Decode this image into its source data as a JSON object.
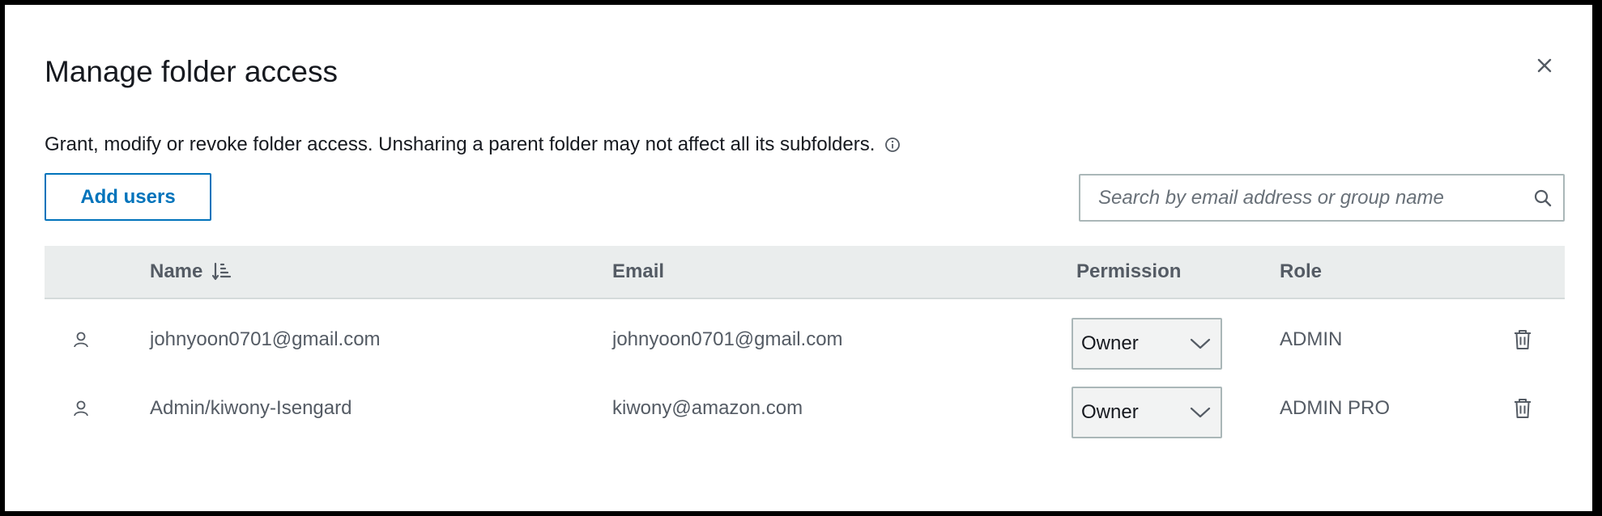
{
  "dialog": {
    "title": "Manage folder access",
    "close_icon": "close-icon",
    "description": "Grant, modify or revoke folder access. Unsharing a parent folder may not affect all its subfolders.",
    "info_icon": "info-icon"
  },
  "toolbar": {
    "add_users_label": "Add users",
    "search_placeholder": "Search by email address or group name",
    "search_value": "",
    "search_icon": "search-icon"
  },
  "table": {
    "columns": {
      "name": "Name",
      "email": "Email",
      "permission": "Permission",
      "role": "Role"
    },
    "sort_icon": "sort-descending-icon",
    "rows": [
      {
        "icon": "user-icon",
        "name": "johnyoon0701@gmail.com",
        "email": "johnyoon0701@gmail.com",
        "permission": "Owner",
        "role": "ADMIN",
        "action_icon": "trash-icon"
      },
      {
        "icon": "user-icon",
        "name": "Admin/kiwony-Isengard",
        "email": "kiwony@amazon.com",
        "permission": "Owner",
        "role": "ADMIN PRO",
        "action_icon": "trash-icon"
      }
    ]
  },
  "colors": {
    "accent": "#0073bb",
    "header_bg": "#eaeded",
    "text_primary": "#16191f",
    "text_secondary": "#545b64"
  }
}
